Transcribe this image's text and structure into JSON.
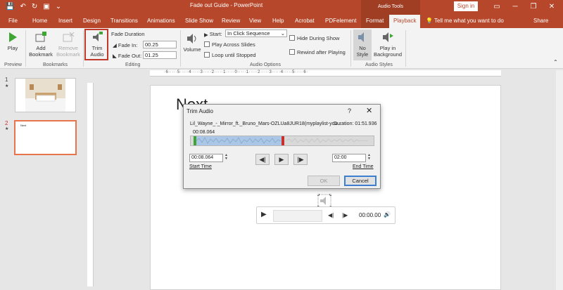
{
  "titlebar": {
    "title": "Fade out Guide  -  PowerPoint",
    "context_tab_group": "Audio Tools",
    "signin": "Sign in",
    "qat": {
      "save": "💾",
      "undo": "↶",
      "redo": "↻",
      "present": "▣",
      "more": "⌄"
    },
    "win": {
      "ribbon_opts": "▭",
      "min": "─",
      "max": "❐",
      "close": "✕"
    }
  },
  "tabs": [
    "File",
    "Home",
    "Insert",
    "Design",
    "Transitions",
    "Animations",
    "Slide Show",
    "Review",
    "View",
    "Help",
    "Acrobat",
    "PDFelement",
    "Format",
    "Playback"
  ],
  "active_tab": "Playback",
  "tellme": "Tell me what you want to do",
  "share": "Share",
  "ribbon": {
    "preview": {
      "play": "Play",
      "group": "Preview"
    },
    "bookmarks": {
      "add": "Add Bookmark",
      "remove": "Remove Bookmark",
      "group": "Bookmarks"
    },
    "editing": {
      "trim": "Trim Audio",
      "fade_duration": "Fade Duration",
      "fade_in_label": "Fade In:",
      "fade_in_value": "00.25",
      "fade_out_label": "Fade Out:",
      "fade_out_value": "01.25",
      "group": "Editing"
    },
    "audio_options": {
      "volume": "Volume",
      "start_label": "Start:",
      "start_value": "In Click Sequence",
      "play_across": "Play Across Slides",
      "loop": "Loop until Stopped",
      "hide": "Hide During Show",
      "rewind": "Rewind after Playing",
      "group": "Audio Options"
    },
    "audio_styles": {
      "no_style": "No Style",
      "play_bg": "Play in Background",
      "group": "Audio Styles"
    }
  },
  "thumbs": [
    {
      "num": "1",
      "star": "★",
      "label": ""
    },
    {
      "num": "2",
      "star": "★",
      "label": "Next"
    }
  ],
  "ruler": {
    "ticks": "·6·····5·····4·····3·····2·····1·····0·····1·····2·····3·····4·····5·····6·"
  },
  "slide": {
    "title": "Next"
  },
  "player": {
    "play": "▶",
    "back": "◀|",
    "fwd": "|▶",
    "time": "00:00.00",
    "vol": "🔊"
  },
  "dialog": {
    "title": "Trim Audio",
    "help": "?",
    "close": "✕",
    "filename": "Lil_Wayne_-_Mirror_ft._Bruno_Mars-OZLUa8JUR18(myplaylist-you...",
    "duration": "Duration: 01:51.936",
    "current_time": "00:08.064",
    "start_value": "00:08.064",
    "start_label": "Start Time",
    "end_value": "02:00",
    "end_label": "End Time",
    "prev": "◀|",
    "play": "▶",
    "next": "|▶",
    "ok": "OK",
    "cancel": "Cancel"
  },
  "colors": {
    "accent": "#b7472a",
    "trim_highlight": "#c0392b",
    "selection": "#aac7e8",
    "start_marker": "#3fa535",
    "end_marker": "#c9302c"
  }
}
